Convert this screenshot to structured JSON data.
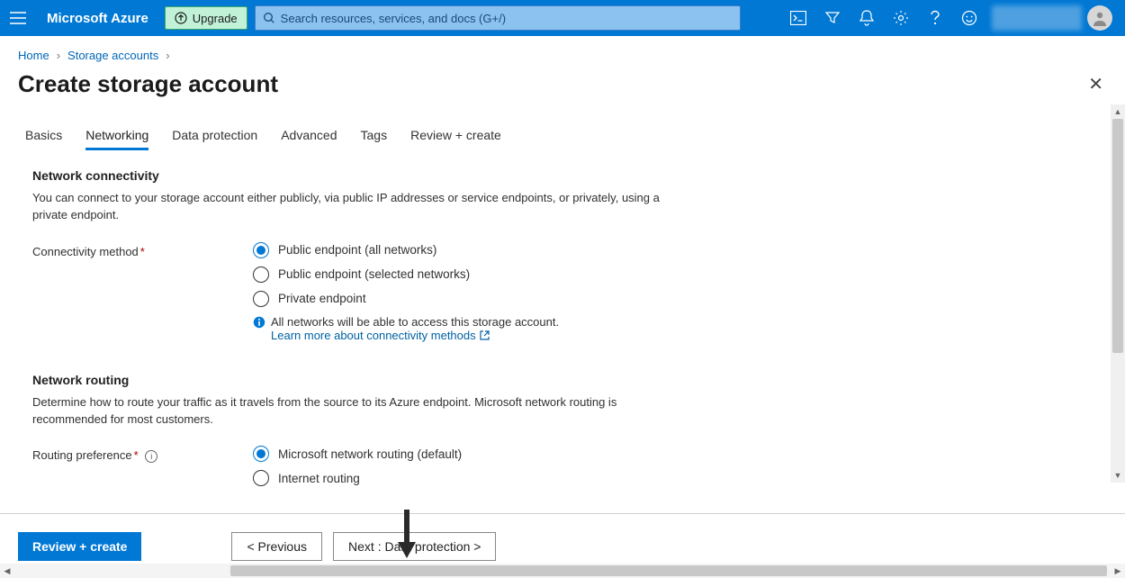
{
  "header": {
    "brand": "Microsoft Azure",
    "upgrade_label": "Upgrade",
    "search_placeholder": "Search resources, services, and docs (G+/)"
  },
  "breadcrumb": {
    "items": [
      "Home",
      "Storage accounts"
    ]
  },
  "page": {
    "title": "Create storage account"
  },
  "tabs": [
    {
      "label": "Basics"
    },
    {
      "label": "Networking"
    },
    {
      "label": "Data protection"
    },
    {
      "label": "Advanced"
    },
    {
      "label": "Tags"
    },
    {
      "label": "Review + create"
    }
  ],
  "connectivity": {
    "section_title": "Network connectivity",
    "section_desc": "You can connect to your storage account either publicly, via public IP addresses or service endpoints, or privately, using a private endpoint.",
    "field_label": "Connectivity method",
    "options": [
      "Public endpoint (all networks)",
      "Public endpoint (selected networks)",
      "Private endpoint"
    ],
    "info_text": "All networks will be able to access this storage account.",
    "learn_link": "Learn more about connectivity methods"
  },
  "routing": {
    "section_title": "Network routing",
    "section_desc": "Determine how to route your traffic as it travels from the source to its Azure endpoint. Microsoft network routing is recommended for most customers.",
    "field_label": "Routing preference",
    "options": [
      "Microsoft network routing (default)",
      "Internet routing"
    ]
  },
  "footer": {
    "review": "Review + create",
    "previous": "< Previous",
    "next": "Next : Data protection >"
  }
}
